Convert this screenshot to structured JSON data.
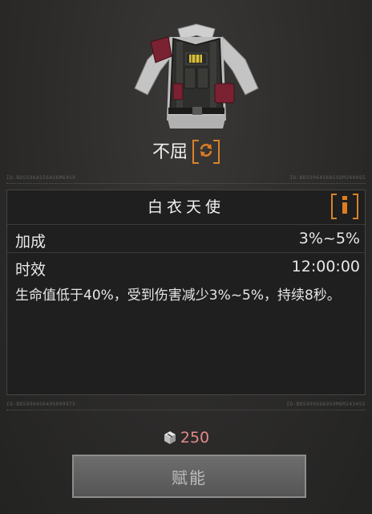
{
  "item": {
    "name": "不屈",
    "icon": "tactical-vest-image",
    "swap_icon": "refresh-icon"
  },
  "serials": {
    "top_left": "IO-BDSS96A556AS6M64S0",
    "top_right": "IO-BDS9964S6A5S6M2404S5",
    "bottom_left": "IO-BDS9964S649S899975",
    "bottom_right": "IO-BDS999S6A9S9M6M2434S5"
  },
  "panel": {
    "title": "白衣天使",
    "info_icon": "info-icon",
    "rows": [
      {
        "label": "加成",
        "value": "3%~5%"
      },
      {
        "label": "时效",
        "value": "12:00:00"
      }
    ],
    "description": "生命值低于40%，受到伤害减少3%~5%，持续8秒。"
  },
  "cost": {
    "icon": "currency-cube-icon",
    "amount": "250"
  },
  "action_button": {
    "label": "赋能"
  },
  "colors": {
    "accent": "#d9822b",
    "cost": "#e48a8a",
    "button_bg": "#616161"
  }
}
